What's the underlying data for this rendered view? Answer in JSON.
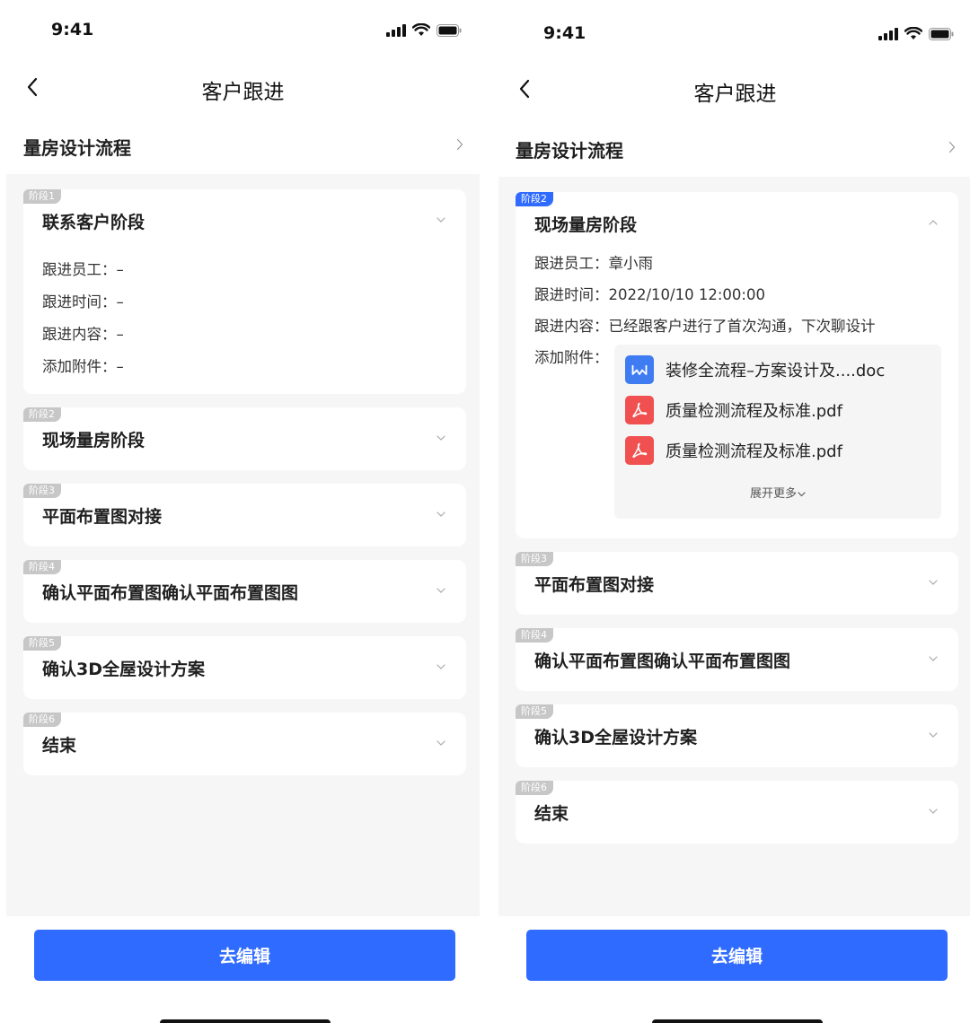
{
  "status_bar": {
    "time": "9:41"
  },
  "nav": {
    "title": "客户跟进"
  },
  "flow": {
    "label": "量房设计流程"
  },
  "detail_labels": {
    "staff": "跟进员工：",
    "time": "跟进时间：",
    "content": "跟进内容：",
    "attachment": "添加附件："
  },
  "left_screen": {
    "stages": [
      {
        "tag": "阶段1",
        "name": "联系客户阶段",
        "expanded": true,
        "staff": "–",
        "time": "–",
        "content": "–",
        "attachment": "–"
      },
      {
        "tag": "阶段2",
        "name": "现场量房阶段",
        "expanded": false
      },
      {
        "tag": "阶段3",
        "name": "平面布置图对接",
        "expanded": false
      },
      {
        "tag": "阶段4",
        "name": "确认平面布置图确认平面布置图图",
        "expanded": false
      },
      {
        "tag": "阶段5",
        "name": "确认3D全屋设计方案",
        "expanded": false
      },
      {
        "tag": "阶段6",
        "name": "结束",
        "expanded": false
      }
    ]
  },
  "right_screen": {
    "stages": [
      {
        "tag": "阶段2",
        "name": "现场量房阶段",
        "expanded": true,
        "active": true,
        "staff": "章小雨",
        "time": "2022/10/10 12:00:00",
        "content": "已经跟客户进行了首次沟通，下次聊设计",
        "files": [
          {
            "name": "装修全流程–方案设计及....doc",
            "icon": "word-doc-icon"
          },
          {
            "name": "质量检测流程及标准.pdf",
            "icon": "pdf-icon"
          },
          {
            "name": "质量检测流程及标准.pdf",
            "icon": "pdf-icon"
          }
        ],
        "expand_more": "展开更多"
      },
      {
        "tag": "阶段3",
        "name": "平面布置图对接",
        "expanded": false
      },
      {
        "tag": "阶段4",
        "name": "确认平面布置图确认平面布置图图",
        "expanded": false
      },
      {
        "tag": "阶段5",
        "name": "确认3D全屋设计方案",
        "expanded": false
      },
      {
        "tag": "阶段6",
        "name": "结束",
        "expanded": false
      }
    ]
  },
  "edit_button": {
    "label": "去编辑"
  },
  "colors": {
    "primary": "#2f6bff",
    "tag_inactive": "#c7c7c7",
    "background": "#f6f6f7",
    "pdf": "#f0504f",
    "doc": "#3f7cf2"
  }
}
